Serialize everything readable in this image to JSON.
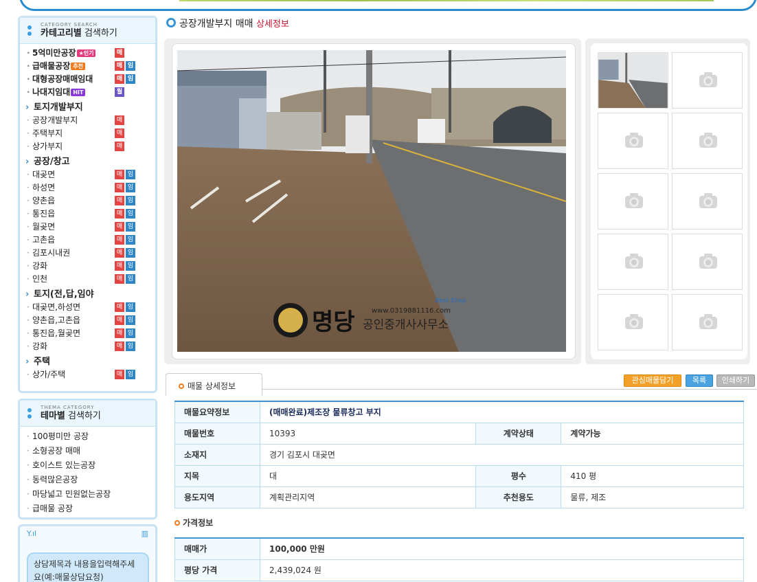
{
  "sidebar": {
    "category_box": {
      "subtitle": "CATEGORY SEARCH",
      "title_bold": "카테고리별",
      "title_rest": " 검색하기",
      "items": [
        {
          "label": "5억미만공장",
          "badge": "★인기",
          "tags": [
            "매"
          ],
          "kind": "main"
        },
        {
          "label": "급매물공장",
          "badge": "추천",
          "tags": [
            "매",
            "임"
          ],
          "kind": "main"
        },
        {
          "label": "대형공장매매임대",
          "badge": "",
          "tags": [
            "매",
            "임"
          ],
          "kind": "main"
        },
        {
          "label": "나대지임대",
          "badge": "HIT",
          "tags": [
            "월"
          ],
          "kind": "main"
        },
        {
          "label": "토지개발부지",
          "badge": "",
          "tags": [],
          "kind": "sec"
        },
        {
          "label": "공장개발부지",
          "badge": "",
          "tags": [
            "매"
          ],
          "kind": "sub"
        },
        {
          "label": "주택부지",
          "badge": "",
          "tags": [
            "매"
          ],
          "kind": "sub"
        },
        {
          "label": "상가부지",
          "badge": "",
          "tags": [
            "매"
          ],
          "kind": "sub"
        },
        {
          "label": "공장/창고",
          "badge": "",
          "tags": [],
          "kind": "sec"
        },
        {
          "label": "대곶면",
          "badge": "",
          "tags": [
            "매",
            "임"
          ],
          "kind": "sub"
        },
        {
          "label": "하성면",
          "badge": "",
          "tags": [
            "매",
            "임"
          ],
          "kind": "sub"
        },
        {
          "label": "양촌읍",
          "badge": "",
          "tags": [
            "매",
            "임"
          ],
          "kind": "sub"
        },
        {
          "label": "통진읍",
          "badge": "",
          "tags": [
            "매",
            "임"
          ],
          "kind": "sub"
        },
        {
          "label": "월곶면",
          "badge": "",
          "tags": [
            "매",
            "임"
          ],
          "kind": "sub"
        },
        {
          "label": "고촌읍",
          "badge": "",
          "tags": [
            "매",
            "임"
          ],
          "kind": "sub"
        },
        {
          "label": "김포시내권",
          "badge": "",
          "tags": [
            "매",
            "임"
          ],
          "kind": "sub"
        },
        {
          "label": "강화",
          "badge": "",
          "tags": [
            "매",
            "임"
          ],
          "kind": "sub"
        },
        {
          "label": "인천",
          "badge": "",
          "tags": [
            "매",
            "임"
          ],
          "kind": "sub"
        },
        {
          "label": "토지(전,답,임야",
          "badge": "",
          "tags": [],
          "kind": "sec"
        },
        {
          "label": "대곶면,하성면",
          "badge": "",
          "tags": [
            "매",
            "임"
          ],
          "kind": "sub"
        },
        {
          "label": "양촌읍,고촌읍",
          "badge": "",
          "tags": [
            "매",
            "임"
          ],
          "kind": "sub"
        },
        {
          "label": "통진읍,월곶면",
          "badge": "",
          "tags": [
            "매",
            "임"
          ],
          "kind": "sub"
        },
        {
          "label": "강화",
          "badge": "",
          "tags": [
            "매",
            "임"
          ],
          "kind": "sub"
        },
        {
          "label": "주택",
          "badge": "",
          "tags": [],
          "kind": "sec"
        },
        {
          "label": "상가/주택",
          "badge": "",
          "tags": [
            "매",
            "임"
          ],
          "kind": "sub"
        }
      ]
    },
    "theme_box": {
      "subtitle": "THEMA CATEGORY",
      "title_bold": "테마별",
      "title_rest": " 검색하기",
      "items": [
        "100평미만 공장",
        "소형공장 매매",
        "호이스트 있는공장",
        "동력많은공장",
        "마당넓고 민원없는공장",
        "급매물 공장"
      ]
    },
    "consult": {
      "signal": "Y.ıl",
      "battery": "▥",
      "message": "상담제목과 내용을입력해주세요(예:매물상담요청)"
    }
  },
  "page": {
    "title_main": "공장개발부지 매매",
    "title_sub": "상세정보"
  },
  "photo": {
    "watermark_name": "명당",
    "watermark_sub": "공인중개사사무소",
    "watermark_url": "www.0319881116.com",
    "logo_text": "Best Shop"
  },
  "tabs": {
    "active": "매물 상세정보",
    "buttons": {
      "fav": "관심매물담기",
      "list": "목록",
      "print": "인쇄하기"
    }
  },
  "details": {
    "summary_label": "매물요약정보",
    "summary_value": "(매매완료)제조장 물류창고 부지",
    "number_label": "매물번호",
    "number_value": "10393",
    "status_label": "계약상태",
    "status_value": "계약가능",
    "address_label": "소재지",
    "address_value": "경기 김포시 대곶면",
    "landtype_label": "지목",
    "landtype_value": "대",
    "area_label": "평수",
    "area_value": "410 평",
    "zone_label": "용도지역",
    "zone_value": "계획관리지역",
    "use_label": "추천용도",
    "use_value": "물류, 제조"
  },
  "price": {
    "section_title": "가격정보",
    "sale_label": "매매가",
    "sale_value": "100,000 만원",
    "per_label": "평당 가격",
    "per_value": "2,439,024 원"
  }
}
